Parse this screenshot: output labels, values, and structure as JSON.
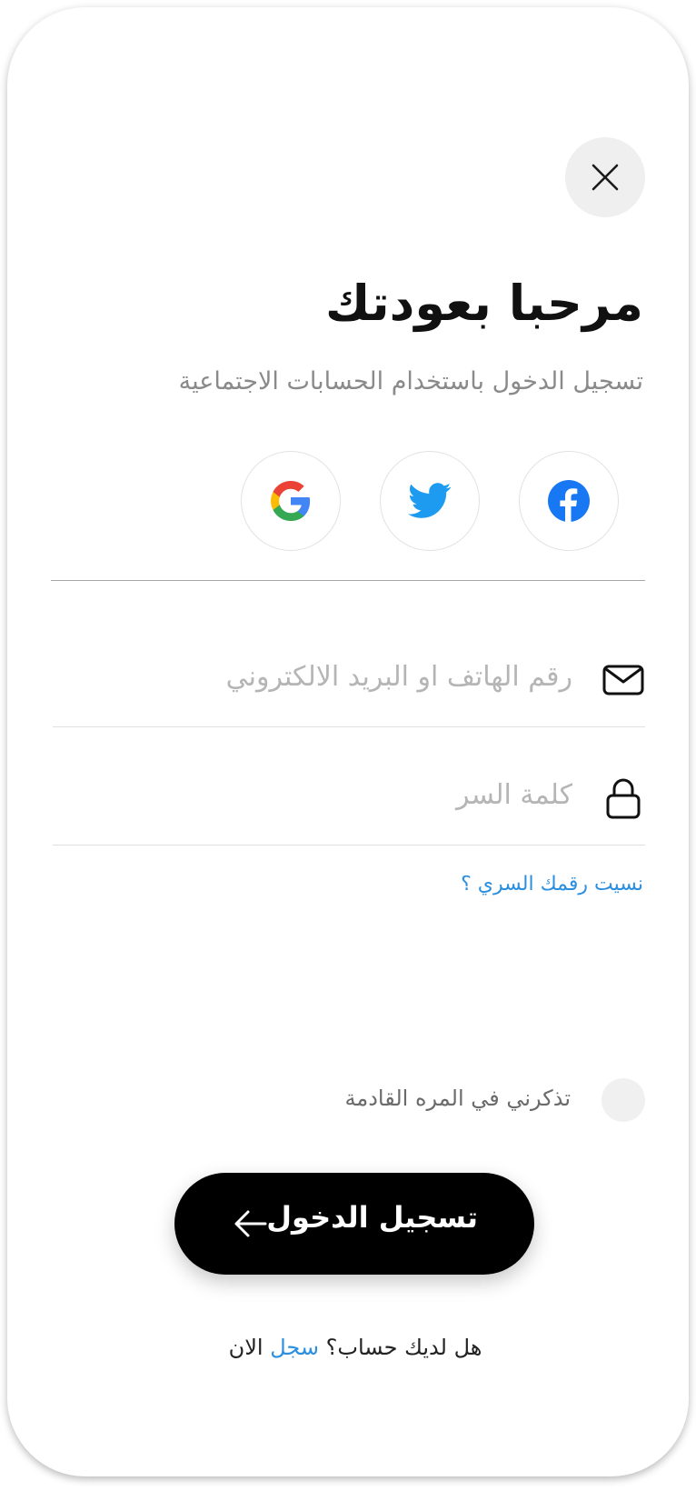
{
  "header": {
    "title": "مرحبا بعودتك",
    "subtitle": "تسجيل الدخول باستخدام الحسابات الاجتماعية"
  },
  "icons": {
    "close": "close-icon",
    "facebook": "facebook-icon",
    "twitter": "twitter-icon",
    "google": "google-icon",
    "email": "envelope-icon",
    "password": "lock-icon",
    "submit": "arrow-left-icon"
  },
  "form": {
    "identifier_placeholder": "رقم الهاتف او البريد الالكتروني",
    "identifier_value": "",
    "password_placeholder": "كلمة السر",
    "password_value": "",
    "forgot_label": "نسيت رقمك السري ؟",
    "remember_label": "تذكرني في المره القادمة",
    "remember_checked": false,
    "submit_label": "تسجيل الدخول"
  },
  "footer": {
    "prompt": "هل لديك حساب؟",
    "link": "سجل",
    "suffix": "الان"
  },
  "colors": {
    "accent": "#2b8fe0",
    "facebook": "#1877f2",
    "twitter": "#1d9bf0",
    "button": "#000000"
  }
}
